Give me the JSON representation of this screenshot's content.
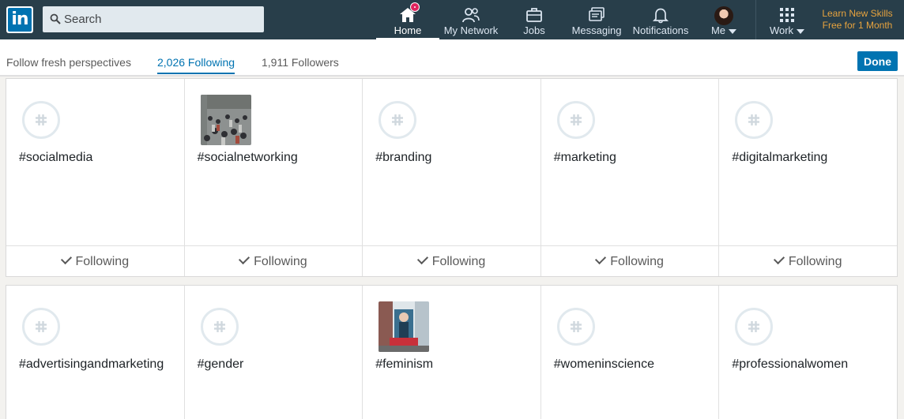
{
  "nav": {
    "logo_text": "in",
    "search_placeholder": "Search",
    "items": [
      {
        "label": "Home",
        "icon": "home-icon"
      },
      {
        "label": "My Network",
        "icon": "network-icon"
      },
      {
        "label": "Jobs",
        "icon": "briefcase-icon"
      },
      {
        "label": "Messaging",
        "icon": "messaging-icon"
      },
      {
        "label": "Notifications",
        "icon": "bell-icon"
      },
      {
        "label": "Me",
        "icon": "avatar"
      },
      {
        "label": "Work",
        "icon": "grid-icon"
      }
    ],
    "promo_line1": "Learn New Skills",
    "promo_line2": "Free for 1 Month"
  },
  "subheader": {
    "tab_perspectives": "Follow fresh perspectives",
    "tab_following": "2,026 Following",
    "tab_followers": "1,911 Followers",
    "done_label": "Done"
  },
  "topics": [
    {
      "name": "#socialmedia",
      "image": "hashtag-icon",
      "button": "Following"
    },
    {
      "name": "#socialnetworking",
      "image": "crowd-photo",
      "button": "Following"
    },
    {
      "name": "#branding",
      "image": "hashtag-icon",
      "button": "Following"
    },
    {
      "name": "#marketing",
      "image": "hashtag-icon",
      "button": "Following"
    },
    {
      "name": "#digitalmarketing",
      "image": "hashtag-icon",
      "button": "Following"
    },
    {
      "name": "#advertisingandmarketing",
      "image": "hashtag-icon"
    },
    {
      "name": "#gender",
      "image": "hashtag-icon"
    },
    {
      "name": "#feminism",
      "image": "street-art-photo"
    },
    {
      "name": "#womeninscience",
      "image": "hashtag-icon"
    },
    {
      "name": "#professionalwomen",
      "image": "hashtag-icon"
    }
  ],
  "colors": {
    "nav_bg": "#283e4a",
    "brand_blue": "#0073b1",
    "promo": "#e7a33e",
    "badge": "#e0245e"
  }
}
